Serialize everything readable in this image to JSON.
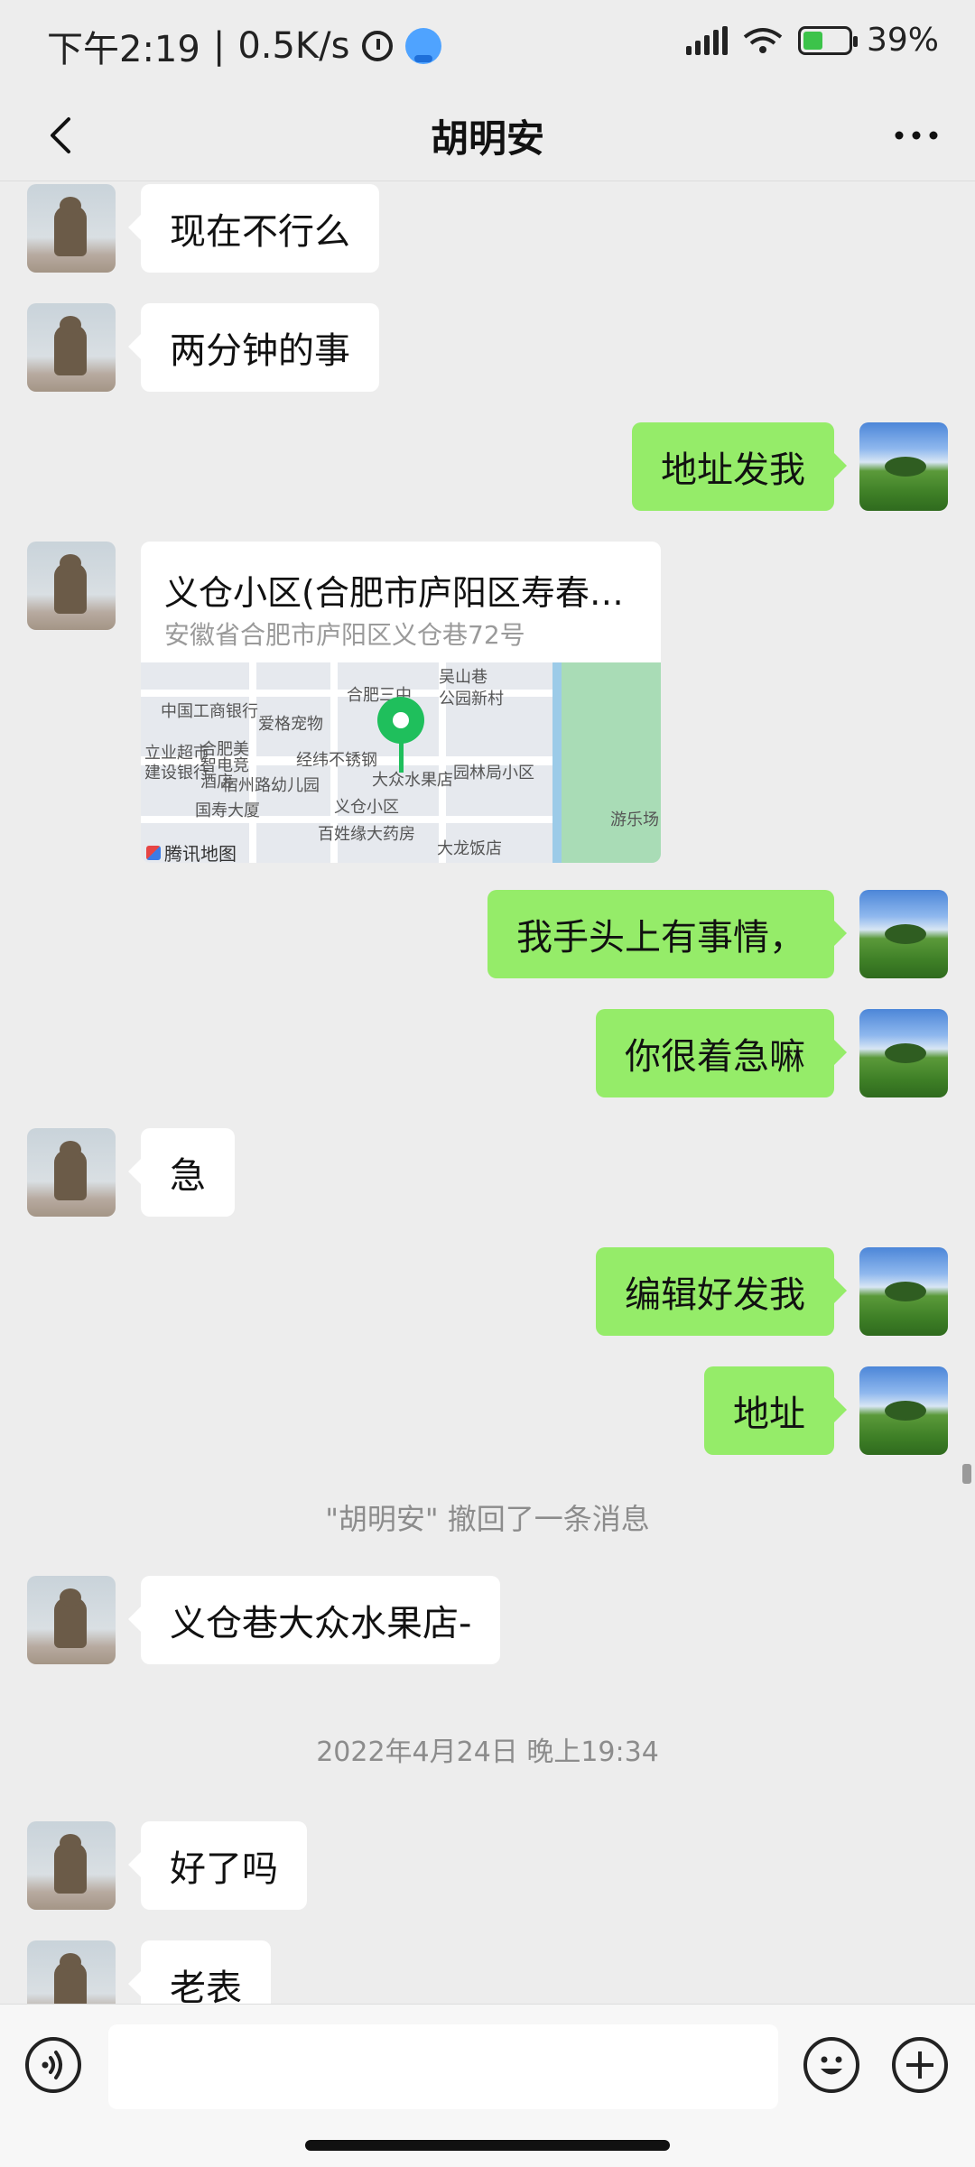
{
  "status_bar": {
    "time": "下午2:19",
    "separator": "|",
    "speed": "0.5K/s",
    "battery": "39%"
  },
  "header": {
    "title": "胡明安"
  },
  "messages": {
    "m1": "现在不行么",
    "m2": "两分钟的事",
    "m3": "地址发我",
    "location": {
      "title": "义仓小区(合肥市庐阳区寿春…",
      "address": "安徽省合肥市庐阳区义仓巷72号",
      "map_labels": [
        "中国工商银行",
        "爱格宠物",
        "合肥三中",
        "吴山巷",
        "公园新村",
        "立业超市",
        "合肥美智电竞酒店",
        "经纬不锈钢",
        "园林局小区",
        "建设银行",
        "宿州路幼儿园",
        "大众水果店",
        "国寿大厦",
        "义仓小区",
        "游乐场",
        "百姓缘大药房",
        "大龙饭店"
      ],
      "map_provider": "腾讯地图"
    },
    "m4": "我手头上有事情，",
    "m5": "你很着急嘛",
    "m6": "急",
    "m7": "编辑好发我",
    "m8": "地址",
    "recall_notice": "\"胡明安\" 撤回了一条消息",
    "m9": "义仓巷大众水果店-",
    "timestamp": "2022年4月24日 晚上19:34",
    "m10": "好了吗",
    "m11": "老表"
  },
  "input": {
    "placeholder": ""
  },
  "icons": {
    "back": "chevron-left-icon",
    "more": "more-dots-icon",
    "voice": "voice-icon",
    "emoji": "emoji-icon",
    "plus": "plus-icon"
  },
  "colors": {
    "bubble_self": "#95ec69",
    "bubble_other": "#ffffff",
    "background": "#ededed",
    "pin": "#1fbf5c"
  }
}
